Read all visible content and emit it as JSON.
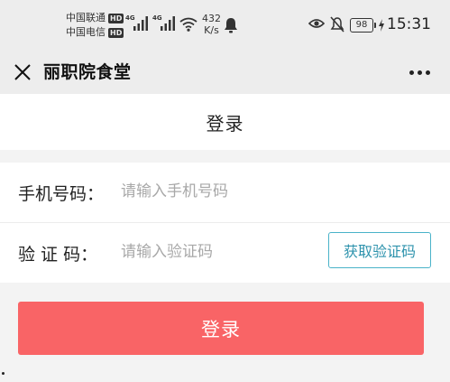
{
  "status_bar": {
    "carrier_1": "中国联通",
    "carrier_2": "中国电信",
    "hd_badge": "HD",
    "network_1": "4G",
    "network_2": "4G",
    "speed_value": "432",
    "speed_unit": "K/s",
    "battery_level": "98",
    "time": "15:31",
    "icons": [
      "signal-icon",
      "wifi-icon",
      "notification-bell-icon",
      "eye-icon",
      "mute-icon",
      "battery-icon",
      "charging-icon"
    ]
  },
  "nav": {
    "title": "丽职院食堂",
    "close_icon": "close-icon",
    "more_icon": "more-icon"
  },
  "page": {
    "title": "登录"
  },
  "form": {
    "phone": {
      "label": "手机号码：",
      "value": "",
      "placeholder": "请输入手机号码"
    },
    "code": {
      "label": "验 证 码：",
      "value": "",
      "placeholder": "请输入验证码"
    },
    "get_code_label": "获取验证码"
  },
  "login_label": "登录",
  "colors": {
    "accent": "#f96466",
    "code_button": "#2e93ad",
    "background": "#f3f3f3"
  }
}
